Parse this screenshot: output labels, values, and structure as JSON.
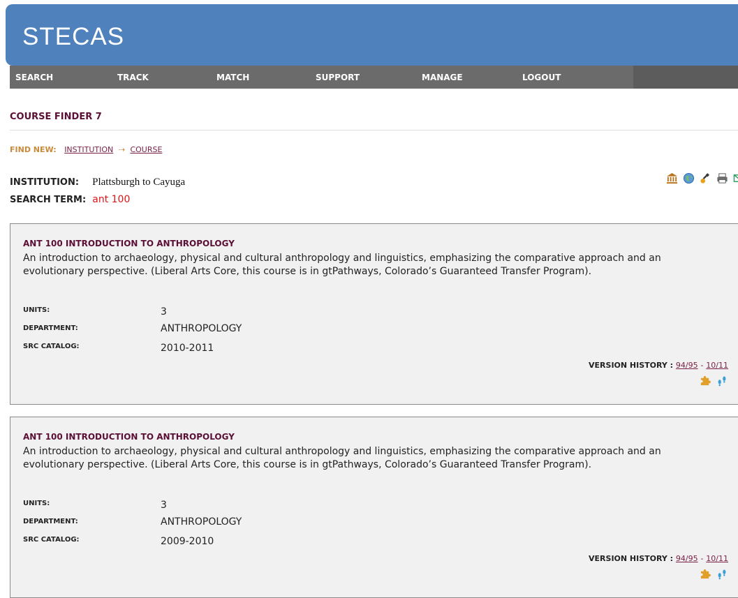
{
  "app": {
    "brand": "STECAS"
  },
  "nav": [
    "SEARCH",
    "TRACK",
    "MATCH",
    "SUPPORT",
    "MANAGE",
    "LOGOUT"
  ],
  "page": {
    "title": "COURSE FINDER 7"
  },
  "find_new": {
    "label": "FIND NEW:",
    "institution_link": "INSTITUTION",
    "arrow": "⇢",
    "course_link": "COURSE"
  },
  "search_info": {
    "institution_label": "INSTITUTION:",
    "institution_value": "Plattsburgh to Cayuga",
    "term_label": "SEARCH TERM:",
    "term_value": "ant 100"
  },
  "toolbar_icons": [
    "institution-icon",
    "globe-icon",
    "key-icon",
    "print-icon",
    "email-icon"
  ],
  "colors": {
    "banner": "#4f81bd",
    "nav_bg": "#6b6b6b",
    "title": "#5c0f36",
    "link": "#7a1f45",
    "accent": "#c98a3b",
    "term": "#e31414"
  },
  "courses": [
    {
      "title": "ANT 100  INTRODUCTION TO ANTHROPOLOGY",
      "description": "An introduction to archaeology, physical and cultural anthropology and linguistics, emphasizing the comparative approach and an evolutionary perspective. (Liberal Arts Core, this course is in gtPathways, Colorado’s Guaranteed Transfer Program).",
      "units_label": "UNITS:",
      "units": "3",
      "department_label": "DEPARTMENT:",
      "department": "ANTHROPOLOGY",
      "catalog_label": "SRC CATALOG:",
      "catalog": "2010-2011",
      "version_label": "VERSION HISTORY :",
      "version_from": "94/95",
      "version_sep": "-",
      "version_to": "10/11",
      "icons": [
        "puzzle-icon",
        "footsteps-icon"
      ]
    },
    {
      "title": "ANT 100  INTRODUCTION TO ANTHROPOLOGY",
      "description": "An introduction to archaeology, physical and cultural anthropology and linguistics, emphasizing the comparative approach and an evolutionary perspective. (Liberal Arts Core, this course is in gtPathways, Colorado’s Guaranteed Transfer Program).",
      "units_label": "UNITS:",
      "units": "3",
      "department_label": "DEPARTMENT:",
      "department": "ANTHROPOLOGY",
      "catalog_label": "SRC CATALOG:",
      "catalog": "2009-2010",
      "version_label": "VERSION HISTORY :",
      "version_from": "94/95",
      "version_sep": "-",
      "version_to": "10/11",
      "icons": [
        "puzzle-icon",
        "footsteps-icon"
      ]
    }
  ]
}
